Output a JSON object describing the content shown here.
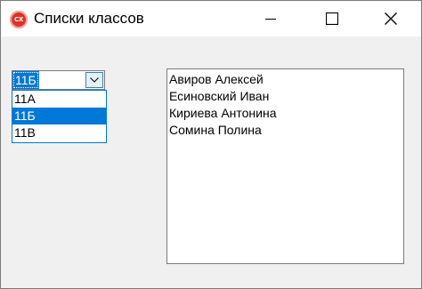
{
  "window": {
    "title": "Списки классов",
    "icon": "cx-app-icon",
    "icon_text": "CX",
    "icon_color": "#d9342b"
  },
  "title_controls": {
    "minimize": "minimize-icon",
    "maximize": "maximize-icon",
    "close": "close-icon"
  },
  "class_combo": {
    "value": "11Б",
    "button_icon": "chevron-down-icon",
    "options": [
      "11А",
      "11Б",
      "11В"
    ],
    "selected_index": 1,
    "accent": "#0078d7"
  },
  "students_list": {
    "items": [
      "Авиров Алексей",
      "Есиновский Иван",
      "Кириева Антонина",
      "Сомина Полина"
    ]
  }
}
